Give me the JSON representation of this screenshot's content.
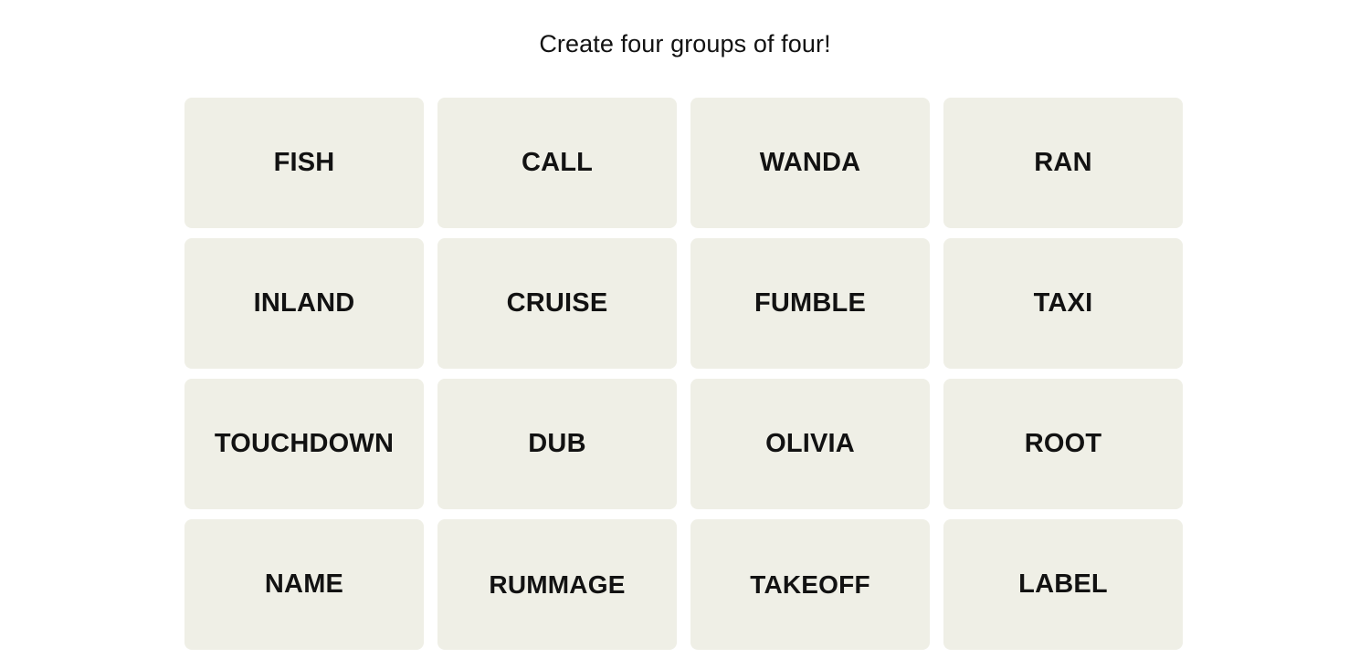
{
  "header": {
    "instruction": "Create four groups of four!"
  },
  "board": {
    "rows": 4,
    "columns": 4,
    "tile_color": "#EFEFE6",
    "text_color": "#121212",
    "background_color": "#FFFFFF",
    "tiles": [
      {
        "label": "FISH"
      },
      {
        "label": "CALL"
      },
      {
        "label": "WANDA"
      },
      {
        "label": "RAN"
      },
      {
        "label": "INLAND"
      },
      {
        "label": "CRUISE"
      },
      {
        "label": "FUMBLE"
      },
      {
        "label": "TAXI"
      },
      {
        "label": "TOUCHDOWN"
      },
      {
        "label": "DUB"
      },
      {
        "label": "OLIVIA"
      },
      {
        "label": "ROOT"
      },
      {
        "label": "NAME"
      },
      {
        "label": "RUMMAGE"
      },
      {
        "label": "TAKEOFF"
      },
      {
        "label": "LABEL"
      }
    ]
  }
}
